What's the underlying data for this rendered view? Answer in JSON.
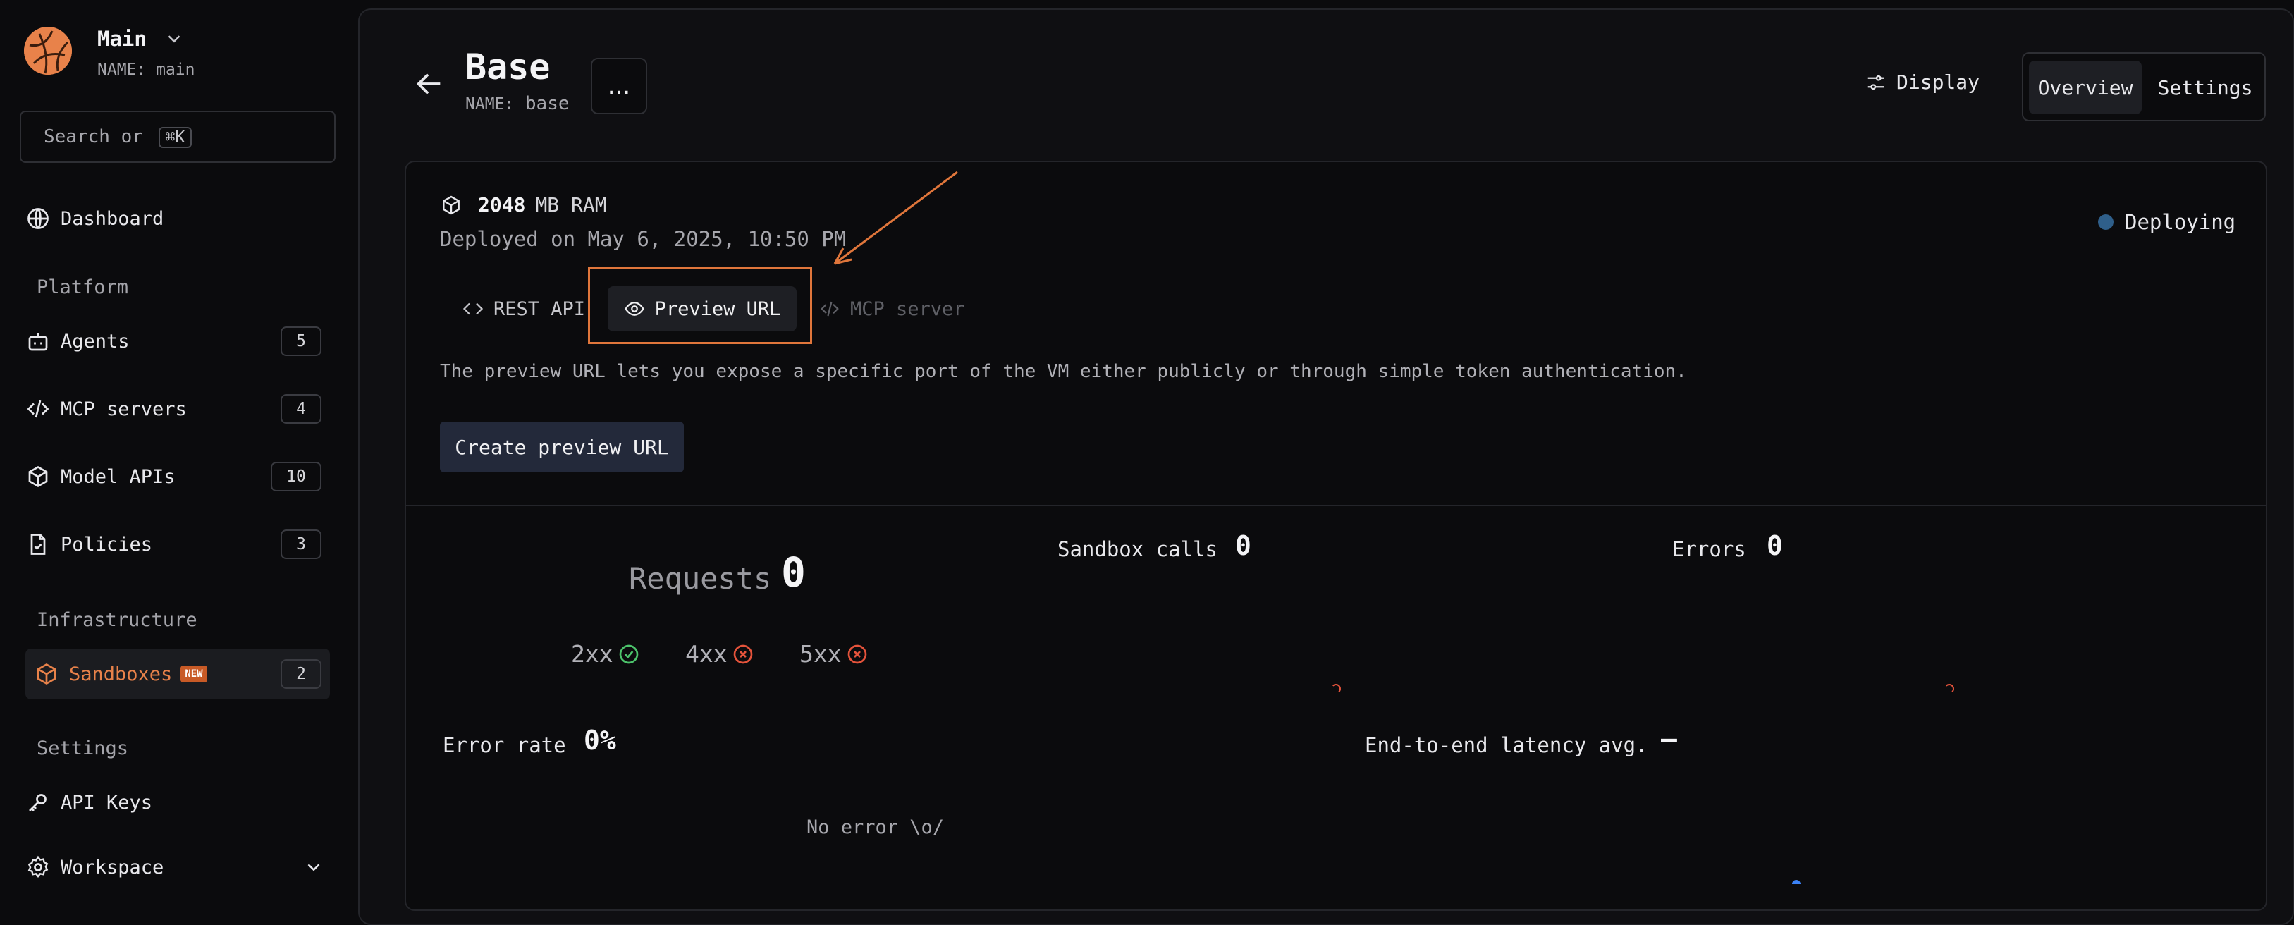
{
  "workspace": {
    "name": "Main",
    "sub_label": "NAME:",
    "sub_value": "main"
  },
  "search": {
    "text": "Search or",
    "shortcut": "⌘K"
  },
  "nav": {
    "dashboard": "Dashboard",
    "platform_header": "Platform",
    "agents": {
      "label": "Agents",
      "count": "5"
    },
    "mcp_servers": {
      "label": "MCP servers",
      "count": "4"
    },
    "model_apis": {
      "label": "Model APIs",
      "count": "10"
    },
    "policies": {
      "label": "Policies",
      "count": "3"
    },
    "infrastructure_header": "Infrastructure",
    "sandboxes": {
      "label": "Sandboxes",
      "tag": "NEW",
      "count": "2"
    },
    "settings_header": "Settings",
    "api_keys": "API Keys",
    "workspace": "Workspace"
  },
  "header": {
    "title": "Base",
    "sub_label": "NAME:",
    "sub_value": "base",
    "more": "...",
    "display": "Display",
    "tabs": {
      "overview": "Overview",
      "settings": "Settings"
    }
  },
  "card": {
    "ram_value": "2048",
    "ram_unit": "MB RAM",
    "deployed": "Deployed on May 6, 2025, 10:50 PM",
    "status": "Deploying",
    "tabs": {
      "rest": "REST API",
      "preview": "Preview URL",
      "mcp": "MCP server"
    },
    "description": "The preview URL lets you expose a specific port of the VM either publicly or through simple token authentication.",
    "create_button": "Create preview URL"
  },
  "stats": {
    "requests_label": "Requests",
    "requests_value": "0",
    "codes": {
      "c2xx": "2xx",
      "c4xx": "4xx",
      "c5xx": "5xx"
    },
    "sandbox_calls_label": "Sandbox calls",
    "sandbox_calls_value": "0",
    "errors_label": "Errors",
    "errors_value": "0",
    "error_rate_label": "Error rate",
    "error_rate_value": "0%",
    "latency_label": "End-to-end latency avg.",
    "latency_value": "–",
    "no_error": "No error \\o/"
  },
  "colors": {
    "accent": "#e8824a",
    "status_dot": "#2f5f8a",
    "ok": "#4cc36b",
    "err": "#e5533b"
  }
}
